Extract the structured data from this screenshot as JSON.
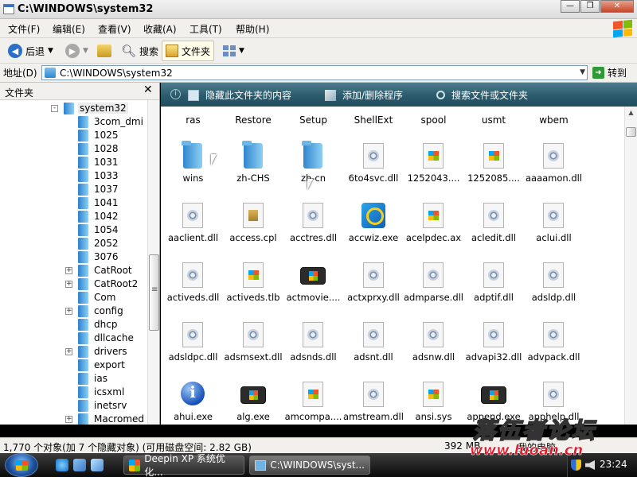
{
  "window": {
    "title": "C:\\WINDOWS\\system32",
    "min": "—",
    "max": "❐",
    "close": "✕"
  },
  "menu": [
    "文件(F)",
    "编辑(E)",
    "查看(V)",
    "收藏(A)",
    "工具(T)",
    "帮助(H)"
  ],
  "toolbar": {
    "back": "后退",
    "search": "搜索",
    "folders": "文件夹"
  },
  "address": {
    "label": "地址(D)",
    "value": "C:\\WINDOWS\\system32",
    "go": "转到"
  },
  "left_pane": {
    "title": "文件夹",
    "close": "✕",
    "tree": [
      {
        "label": "system32",
        "root": true,
        "expander": "-"
      },
      {
        "label": "3com_dmi",
        "expander": ""
      },
      {
        "label": "1025",
        "expander": ""
      },
      {
        "label": "1028",
        "expander": ""
      },
      {
        "label": "1031",
        "expander": ""
      },
      {
        "label": "1033",
        "expander": ""
      },
      {
        "label": "1037",
        "expander": ""
      },
      {
        "label": "1041",
        "expander": ""
      },
      {
        "label": "1042",
        "expander": ""
      },
      {
        "label": "1054",
        "expander": ""
      },
      {
        "label": "2052",
        "expander": ""
      },
      {
        "label": "3076",
        "expander": ""
      },
      {
        "label": "CatRoot",
        "expander": "+"
      },
      {
        "label": "CatRoot2",
        "expander": "+"
      },
      {
        "label": "Com",
        "expander": ""
      },
      {
        "label": "config",
        "expander": "+"
      },
      {
        "label": "dhcp",
        "expander": ""
      },
      {
        "label": "dllcache",
        "expander": ""
      },
      {
        "label": "drivers",
        "expander": "+"
      },
      {
        "label": "export",
        "expander": ""
      },
      {
        "label": "ias",
        "expander": ""
      },
      {
        "label": "icsxml",
        "expander": ""
      },
      {
        "label": "inetsrv",
        "expander": ""
      },
      {
        "label": "Macromed",
        "expander": "+"
      }
    ]
  },
  "tasks": {
    "hide": "隐藏此文件夹的内容",
    "addremove": "添加/删除程序",
    "search": "搜索文件或文件夹"
  },
  "top_labels": [
    "ras",
    "Restore",
    "Setup",
    "ShellExt",
    "spool",
    "usmt",
    "wbem"
  ],
  "files": [
    {
      "name": "wins",
      "icon": "folder"
    },
    {
      "name": "zh-CHS",
      "icon": "folder"
    },
    {
      "name": "zh-cn",
      "icon": "folder"
    },
    {
      "name": "6to4svc.dll",
      "icon": "dll"
    },
    {
      "name": "1252043....",
      "icon": "win"
    },
    {
      "name": "1252085....",
      "icon": "win"
    },
    {
      "name": "aaaamon.dll",
      "icon": "dll"
    },
    {
      "name": "aaclient.dll",
      "icon": "dll"
    },
    {
      "name": "access.cpl",
      "icon": "cpl"
    },
    {
      "name": "acctres.dll",
      "icon": "dll"
    },
    {
      "name": "accwiz.exe",
      "icon": "acc"
    },
    {
      "name": "acelpdec.ax",
      "icon": "win"
    },
    {
      "name": "acledit.dll",
      "icon": "dll"
    },
    {
      "name": "aclui.dll",
      "icon": "dll"
    },
    {
      "name": "activeds.dll",
      "icon": "dll"
    },
    {
      "name": "activeds.tlb",
      "icon": "win"
    },
    {
      "name": "actmovie....",
      "icon": "exe"
    },
    {
      "name": "actxprxy.dll",
      "icon": "dll"
    },
    {
      "name": "admparse.dll",
      "icon": "dll"
    },
    {
      "name": "adptif.dll",
      "icon": "dll"
    },
    {
      "name": "adsldp.dll",
      "icon": "dll"
    },
    {
      "name": "adsldpc.dll",
      "icon": "dll"
    },
    {
      "name": "adsmsext.dll",
      "icon": "dll"
    },
    {
      "name": "adsnds.dll",
      "icon": "dll"
    },
    {
      "name": "adsnt.dll",
      "icon": "dll"
    },
    {
      "name": "adsnw.dll",
      "icon": "dll"
    },
    {
      "name": "advapi32.dll",
      "icon": "dll"
    },
    {
      "name": "advpack.dll",
      "icon": "dll"
    },
    {
      "name": "ahui.exe",
      "icon": "info"
    },
    {
      "name": "alg.exe",
      "icon": "exe"
    },
    {
      "name": "amcompa....",
      "icon": "win"
    },
    {
      "name": "amstream.dll",
      "icon": "dll"
    },
    {
      "name": "ansi.sys",
      "icon": "win"
    },
    {
      "name": "append.exe",
      "icon": "exe"
    },
    {
      "name": "apphelp.dll",
      "icon": "dll"
    }
  ],
  "status": {
    "objects": "1,770 个对象(加 7 个隐藏对象) (可用磁盘空间: 2.82 GB)",
    "size": "392 MB",
    "location": "我的电脑"
  },
  "taskbar": {
    "tasks": [
      "Deepin XP 系统优化...",
      "C:\\WINDOWS\\syst..."
    ],
    "clock": "23:24"
  },
  "watermark": {
    "text": "落伍者论坛",
    "url": "www.luoan.cn"
  }
}
